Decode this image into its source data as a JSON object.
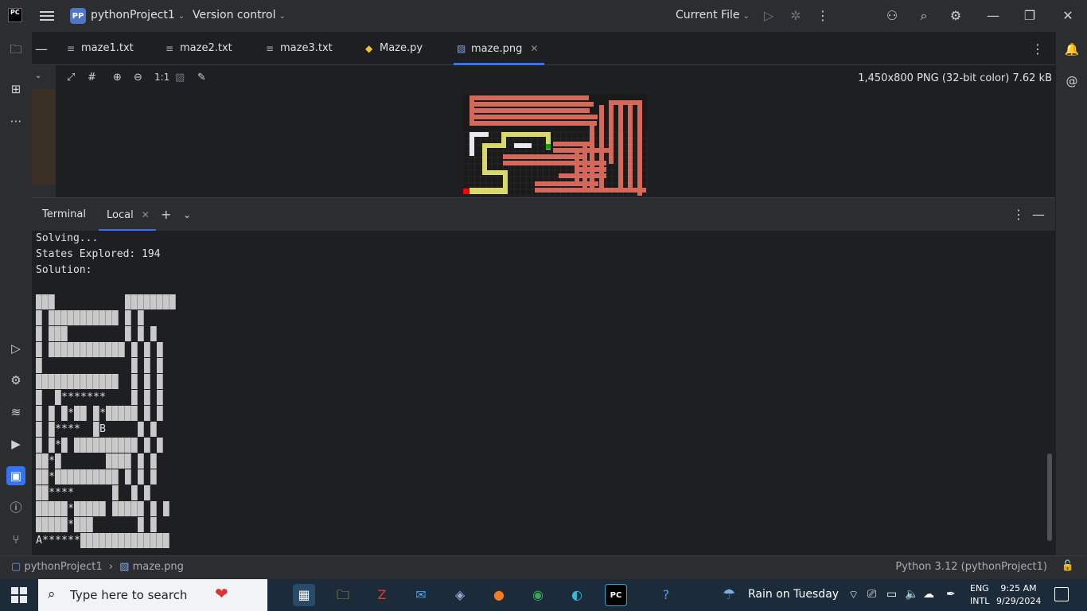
{
  "title_bar": {
    "logo_text": "PC",
    "project_badge": "PP",
    "project_name": "pythonProject1",
    "version_control": "Version control",
    "run_config": "Current File"
  },
  "editor_tabs": [
    {
      "label": "maze1.txt",
      "icon": "text-file-icon"
    },
    {
      "label": "maze2.txt",
      "icon": "text-file-icon"
    },
    {
      "label": "maze3.txt",
      "icon": "text-file-icon"
    },
    {
      "label": "Maze.py",
      "icon": "python-file-icon"
    },
    {
      "label": "maze.png",
      "icon": "image-file-icon",
      "active": true
    }
  ],
  "image_toolbar": {
    "zoom_label": "1:1",
    "image_info": "1,450x800 PNG (32-bit color) 7.62 kB"
  },
  "terminal_panel": {
    "title": "Terminal",
    "tab_label": "Local"
  },
  "terminal_output": {
    "lines": [
      "Solving...",
      "States Explored: 194",
      "Solution:"
    ],
    "maze": [
      "███           ████████",
      "█ ███████████ █ █",
      "█ ███         █ █ █",
      "█ ████████████ █ █ █",
      "█              █ █ █",
      "█████████████  █ █ █",
      "█  █*******    █ █ █",
      "█ █ █*██ █*█████ █ █",
      "█ █****  █B     █ █",
      "█ █*█ ██████████ █ █",
      "██*█       ████ █ █",
      "██*██████████ █ █ █",
      "██****      █  █ █",
      "█████*█████ █████ █ █",
      "█████*███       █ █",
      "A******██████████████"
    ]
  },
  "status_bar": {
    "project": "pythonProject1",
    "file": "maze.png",
    "interpreter": "Python 3.12 (pythonProject1)"
  },
  "taskbar": {
    "search_placeholder": "Type here to search",
    "weather": "Rain on Tuesday",
    "lang_top": "ENG",
    "lang_bottom": "INTL",
    "time": "9:25 AM",
    "date": "9/29/2024"
  },
  "colors": {
    "accent": "#3574f0",
    "wall_red": "#d4685b",
    "path_yellow": "#d8d96a",
    "explored_white": "#e8e8f0",
    "start_red": "#ff0000",
    "goal_green": "#00aa00"
  }
}
